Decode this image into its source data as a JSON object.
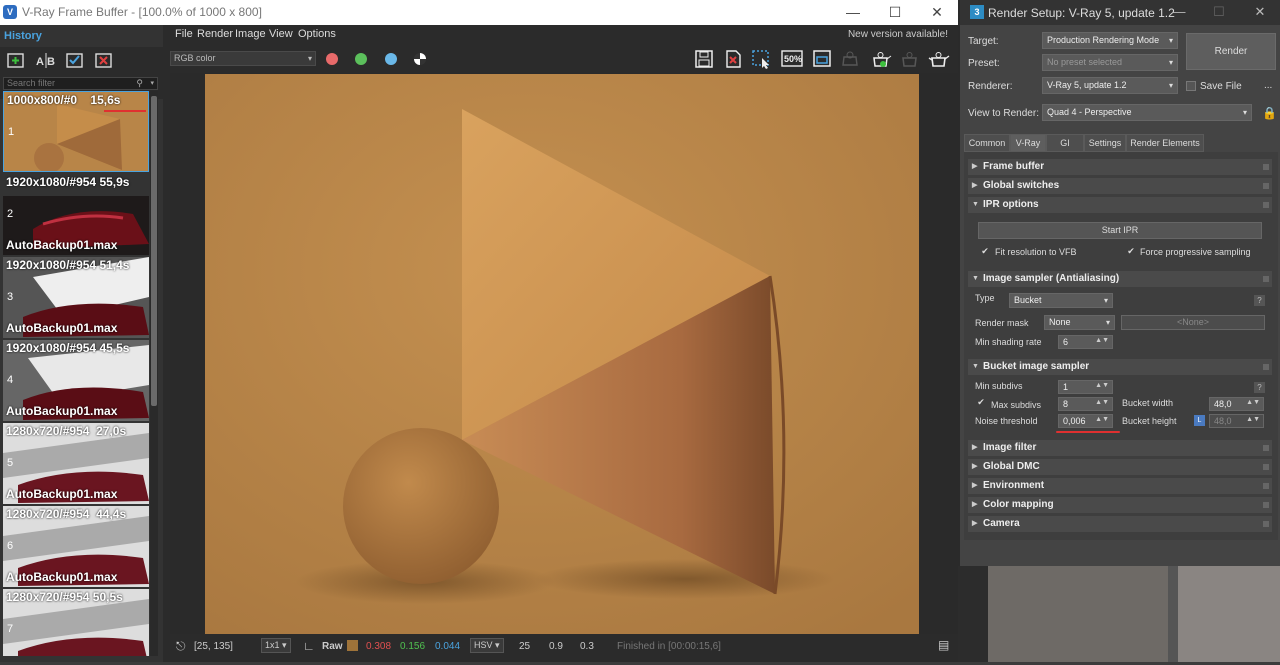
{
  "vfb": {
    "title": "V-Ray Frame Buffer - [100.0% of 1000 x 800]",
    "menu": [
      "File",
      "Render",
      "Image",
      "View",
      "Options"
    ],
    "new_version": "New version available!",
    "channel": "RGB color",
    "history_label": "History",
    "search_placeholder": "Search filter",
    "history": [
      {
        "res": "1000x800/#0",
        "time": "15,6s",
        "num": "1",
        "file": ""
      },
      {
        "res": "1920x1080/#954",
        "time": "55,9s",
        "num": "2",
        "file": "AutoBackup01.max"
      },
      {
        "res": "1920x1080/#954",
        "time": "51,4s",
        "num": "3",
        "file": "AutoBackup01.max"
      },
      {
        "res": "1920x1080/#954",
        "time": "45,5s",
        "num": "4",
        "file": "AutoBackup01.max"
      },
      {
        "res": "1280x720/#954",
        "time": "27,0s",
        "num": "5",
        "file": "AutoBackup01.max"
      },
      {
        "res": "1280x720/#954",
        "time": "44,4s",
        "num": "6",
        "file": "AutoBackup01.max"
      },
      {
        "res": "1280x720/#954",
        "time": "50,5s",
        "num": "7",
        "file": ""
      }
    ],
    "status": {
      "coords": "[25, 135]",
      "ratio": "1x1",
      "mode": "Raw",
      "r": "0.308",
      "g": "0.156",
      "b": "0.044",
      "colorspace": "HSV",
      "h": "25",
      "s": "0.9",
      "v": "0.3",
      "finished": "Finished in [00:00:15,6]"
    },
    "zoom_label": "50%"
  },
  "rs": {
    "title": "Render Setup: V-Ray 5, update 1.2",
    "target_label": "Target:",
    "target": "Production Rendering Mode",
    "preset_label": "Preset:",
    "preset": "No preset selected",
    "renderer_label": "Renderer:",
    "renderer": "V-Ray 5, update 1.2",
    "save_file": "Save File",
    "view_label": "View to Render:",
    "view": "Quad 4 - Perspective",
    "render_button": "Render",
    "more": "...",
    "tabs": [
      "Common",
      "V-Ray",
      "GI",
      "Settings",
      "Render Elements"
    ],
    "rollouts": {
      "frame_buffer": "Frame buffer",
      "global_switches": "Global switches",
      "ipr_options": "IPR options",
      "image_sampler": "Image sampler (Antialiasing)",
      "bucket_sampler": "Bucket image sampler",
      "image_filter": "Image filter",
      "global_dmc": "Global DMC",
      "environment": "Environment",
      "color_mapping": "Color mapping",
      "camera": "Camera"
    },
    "ipr": {
      "start": "Start IPR",
      "fit": "Fit resolution to VFB",
      "force": "Force progressive sampling"
    },
    "sampler": {
      "type_label": "Type",
      "type": "Bucket",
      "mask_label": "Render mask",
      "mask": "None",
      "mask_obj": "<None>",
      "min_shading_label": "Min shading rate",
      "min_shading": "6"
    },
    "bucket": {
      "min_subdivs_label": "Min subdivs",
      "min_subdivs": "1",
      "max_subdivs_label": "Max subdivs",
      "max_subdivs": "8",
      "noise_label": "Noise threshold",
      "noise": "0,006",
      "width_label": "Bucket width",
      "width": "48,0",
      "height_label": "Bucket height",
      "height": "48,0",
      "lock": "L"
    },
    "help": "?"
  }
}
